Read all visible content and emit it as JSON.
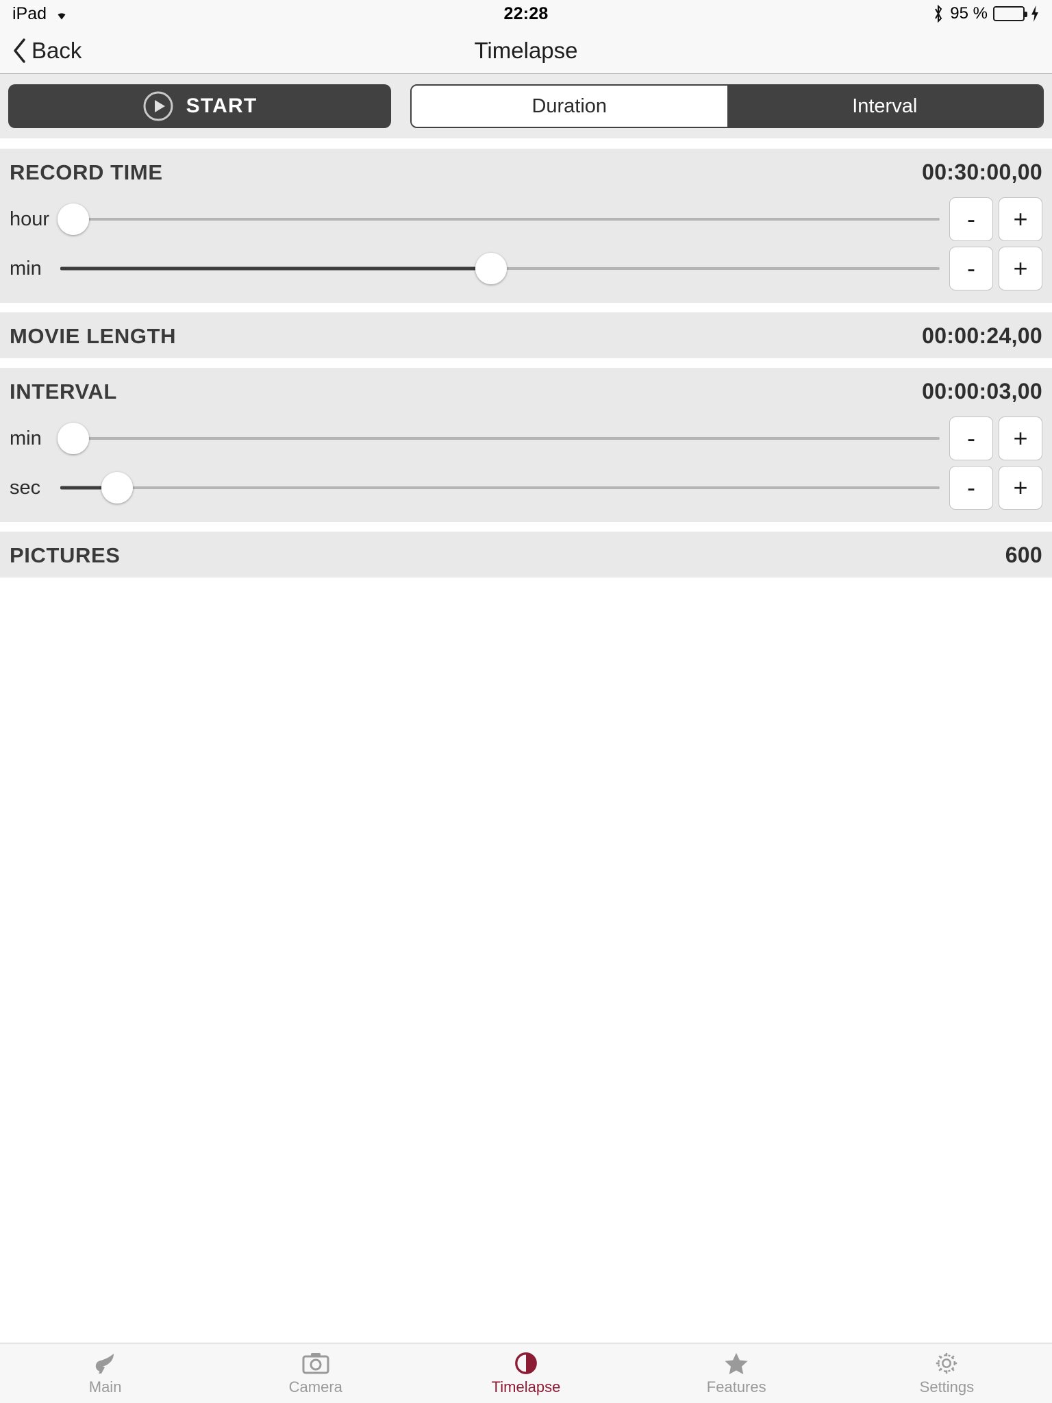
{
  "statusbar": {
    "device": "iPad",
    "wifi_icon": "wifi-icon",
    "time": "22:28",
    "bluetooth_icon": "bluetooth-icon",
    "battery_percent": "95 %",
    "battery_icon": "battery-icon",
    "charging_icon": "charging-bolt-icon",
    "battery_color": "#4cd964",
    "battery_level": 95
  },
  "navbar": {
    "back_label": "Back",
    "back_icon": "chevron-left-icon",
    "title": "Timelapse"
  },
  "toolbar": {
    "start_label": "START",
    "start_icon": "play-circle-icon",
    "start_bg": "#414141",
    "segments": [
      {
        "label": "Duration",
        "selected": true
      },
      {
        "label": "Interval",
        "selected": false
      }
    ]
  },
  "sections": {
    "record_time": {
      "title": "RECORD TIME",
      "value": "00:30:00,00",
      "sliders": [
        {
          "label": "hour",
          "fill_percent": 0,
          "thumb_percent": 1.5,
          "minus": "-",
          "plus": "+"
        },
        {
          "label": "min",
          "fill_percent": 49,
          "thumb_percent": 49,
          "minus": "-",
          "plus": "+"
        }
      ]
    },
    "movie_length": {
      "title": "MOVIE LENGTH",
      "value": "00:00:24,00"
    },
    "interval": {
      "title": "INTERVAL",
      "value": "00:00:03,00",
      "sliders": [
        {
          "label": "min",
          "fill_percent": 0,
          "thumb_percent": 1.5,
          "minus": "-",
          "plus": "+"
        },
        {
          "label": "sec",
          "fill_percent": 6,
          "thumb_percent": 6.5,
          "minus": "-",
          "plus": "+"
        }
      ]
    },
    "pictures": {
      "title": "PICTURES",
      "value": "600"
    }
  },
  "tabbar": {
    "active_color": "#8c1b34",
    "inactive_color": "#9a9a9a",
    "tabs": [
      {
        "label": "Main",
        "icon": "bird-icon",
        "active": false
      },
      {
        "label": "Camera",
        "icon": "camera-icon",
        "active": false
      },
      {
        "label": "Timelapse",
        "icon": "half-moon-icon",
        "active": true
      },
      {
        "label": "Features",
        "icon": "star-icon",
        "active": false
      },
      {
        "label": "Settings",
        "icon": "gear-icon",
        "active": false
      }
    ]
  }
}
